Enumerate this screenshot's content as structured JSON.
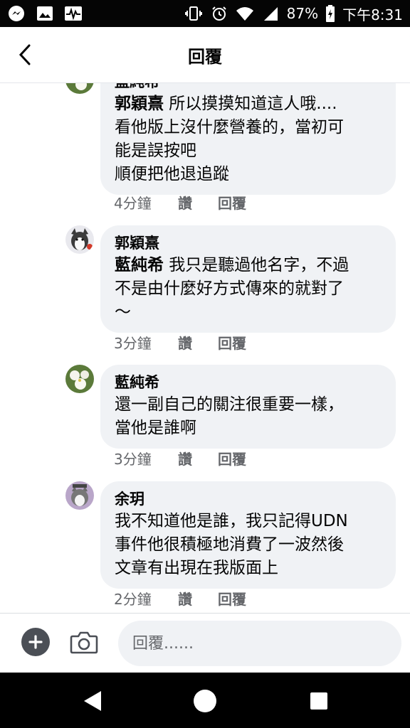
{
  "status_bar": {
    "battery": "87%",
    "time": "下午8:31",
    "left_icons": [
      "messenger-icon",
      "gallery-icon",
      "pulse-icon"
    ],
    "right_icons": [
      "vibrate-icon",
      "alarm-icon",
      "wifi-icon",
      "signal-icon",
      "battery-icon"
    ]
  },
  "header": {
    "title": "回覆"
  },
  "comments": [
    {
      "author": "藍純希",
      "mention": "郭穎熹",
      "text": " 所以摸摸知道這人哦....",
      "lines": [
        "看他版上沒什麼營養的，當初可",
        "能是誤按吧",
        "順便把他退追蹤"
      ],
      "time": "4分鐘",
      "like": "讚",
      "reply": "回覆"
    },
    {
      "author": "郭穎熹",
      "mention": "藍純希",
      "text": " 我只是聽過他名字，不過",
      "lines": [
        "不是由什麼好方式傳來的就對了",
        "～"
      ],
      "time": "3分鐘",
      "like": "讚",
      "reply": "回覆"
    },
    {
      "author": "藍純希",
      "lines": [
        "還一副自己的關注很重要一樣，",
        "當他是誰啊"
      ],
      "time": "3分鐘",
      "like": "讚",
      "reply": "回覆"
    },
    {
      "author": "余玥",
      "lines": [
        "我不知道他是誰，我只記得UDN",
        "事件他很積極地消費了一波然後",
        "文章有出現在我版面上"
      ],
      "time": "2分鐘",
      "like": "讚",
      "reply": "回覆"
    }
  ],
  "composer": {
    "placeholder": "回覆......"
  },
  "colors": {
    "bubble": "#f0f2f5",
    "meta": "#65676b",
    "text": "#050505"
  }
}
